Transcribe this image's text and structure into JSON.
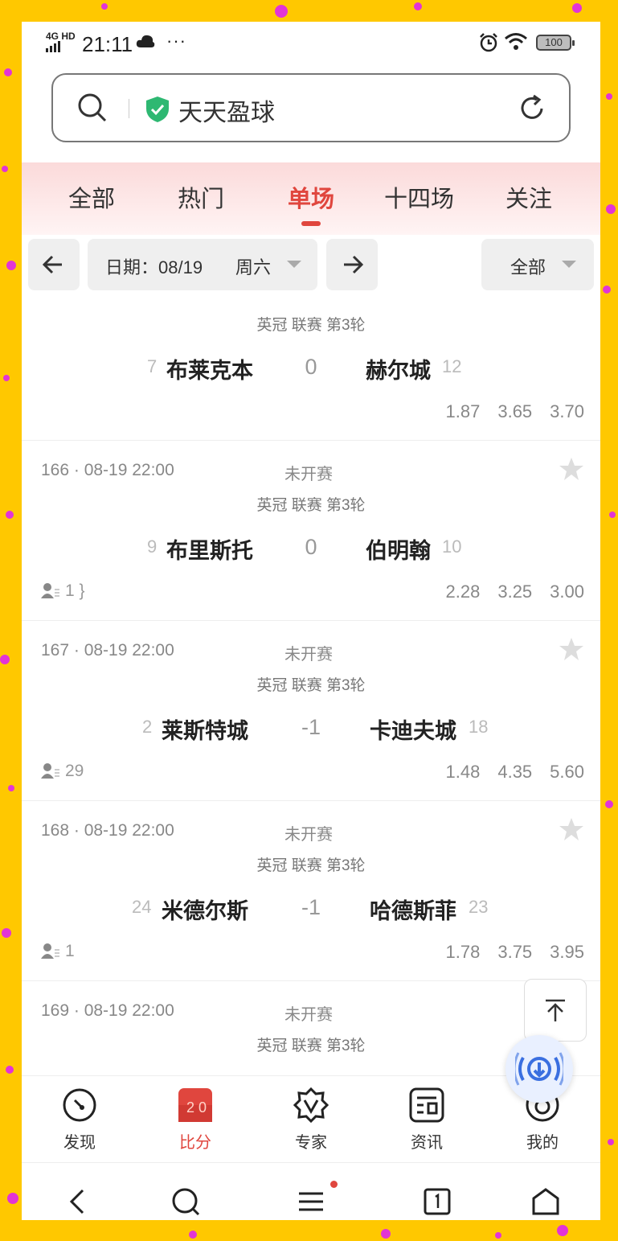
{
  "status_bar": {
    "signal": "4G HD",
    "time": "21:11",
    "more": "···",
    "battery": "100"
  },
  "search": {
    "title": "天天盈球"
  },
  "tabs": [
    {
      "label": "全部"
    },
    {
      "label": "热门"
    },
    {
      "label": "单场"
    },
    {
      "label": "十四场"
    },
    {
      "label": "关注"
    }
  ],
  "filter": {
    "date_label": "日期：08/19",
    "weekday": "周六",
    "scope": "全部"
  },
  "matches": [
    {
      "number": "",
      "league": "英冠 联赛 第3轮",
      "home_rank": "7",
      "home": "布莱克本",
      "handicap": "0",
      "away": "赫尔城",
      "away_rank": "12",
      "fans": "",
      "odds": [
        "1.87",
        "3.65",
        "3.70"
      ]
    },
    {
      "number": "166 · 08-19 22:00",
      "status": "未开赛",
      "league": "英冠 联赛 第3轮",
      "home_rank": "9",
      "home": "布里斯托",
      "handicap": "0",
      "away": "伯明翰",
      "away_rank": "10",
      "fans": "1",
      "odds": [
        "2.28",
        "3.25",
        "3.00"
      ]
    },
    {
      "number": "167 · 08-19 22:00",
      "status": "未开赛",
      "league": "英冠 联赛 第3轮",
      "home_rank": "2",
      "home": "莱斯特城",
      "handicap": "-1",
      "away": "卡迪夫城",
      "away_rank": "18",
      "fans": "29",
      "odds": [
        "1.48",
        "4.35",
        "5.60"
      ]
    },
    {
      "number": "168 · 08-19 22:00",
      "status": "未开赛",
      "league": "英冠 联赛 第3轮",
      "home_rank": "24",
      "home": "米德尔斯",
      "handicap": "-1",
      "away": "哈德斯菲",
      "away_rank": "23",
      "fans": "1",
      "odds": [
        "1.78",
        "3.75",
        "3.95"
      ]
    },
    {
      "number": "169 · 08-19 22:00",
      "status": "未开赛",
      "league": "英冠 联赛 第3轮"
    }
  ],
  "bottom_nav": [
    {
      "label": "发现",
      "icon": "compass-icon"
    },
    {
      "label": "比分",
      "icon": "scoreboard-icon",
      "badge": "2 0"
    },
    {
      "label": "专家",
      "icon": "expert-badge-icon"
    },
    {
      "label": "资讯",
      "icon": "news-icon"
    },
    {
      "label": "我的",
      "icon": "profile-icon"
    }
  ],
  "colors": {
    "accent": "#e0463e",
    "background": "#ffc800",
    "shield": "#2eb872",
    "fab": "#3a6fe0"
  }
}
